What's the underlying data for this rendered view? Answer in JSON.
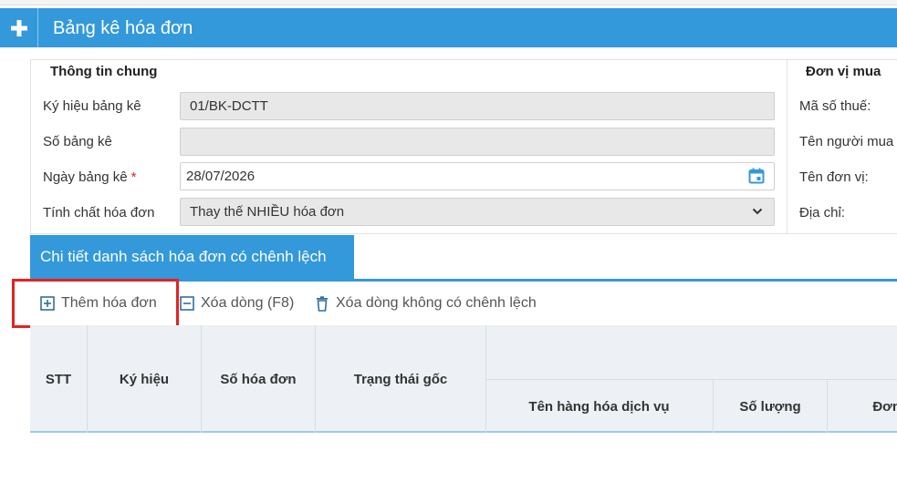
{
  "header": {
    "title": "Bảng kê hóa đơn",
    "plus_icon": "plus-icon"
  },
  "general": {
    "title": "Thông tin chung",
    "fields": [
      {
        "label": "Ký hiệu bảng kê",
        "value": "01/BK-DCTT"
      },
      {
        "label": "Số bảng kê",
        "value": ""
      },
      {
        "label": "Ngày bảng kê",
        "required_mark": "*",
        "value": "28/07/2026",
        "icon": "calendar-icon"
      },
      {
        "label": "Tính chất hóa đơn",
        "value": "Thay thế NHIỀU hóa đơn",
        "icon": "chevron-down-icon"
      }
    ]
  },
  "buyer": {
    "title": "Đơn vị mua",
    "labels": [
      "Mã số thuế:",
      "Tên người mua",
      "Tên đơn vị:",
      "Địa chỉ:"
    ]
  },
  "detail_tab": {
    "label": "Chi tiết danh sách hóa đơn có chênh lệch"
  },
  "toolbar": {
    "add_invoice": "Thêm hóa đơn",
    "delete_row": "Xóa dòng (F8)",
    "delete_no_diff": "Xóa dòng không có chênh lệch"
  },
  "table": {
    "headers": [
      "STT",
      "Ký hiệu",
      "Số hóa đơn",
      "Trạng thái gốc"
    ],
    "sub_headers": [
      "Tên hàng hóa dịch vụ",
      "Số lượng",
      "Đơn"
    ]
  },
  "colors": {
    "accent": "#3399db",
    "highlight": "#e32222",
    "required": "#d9262c"
  }
}
